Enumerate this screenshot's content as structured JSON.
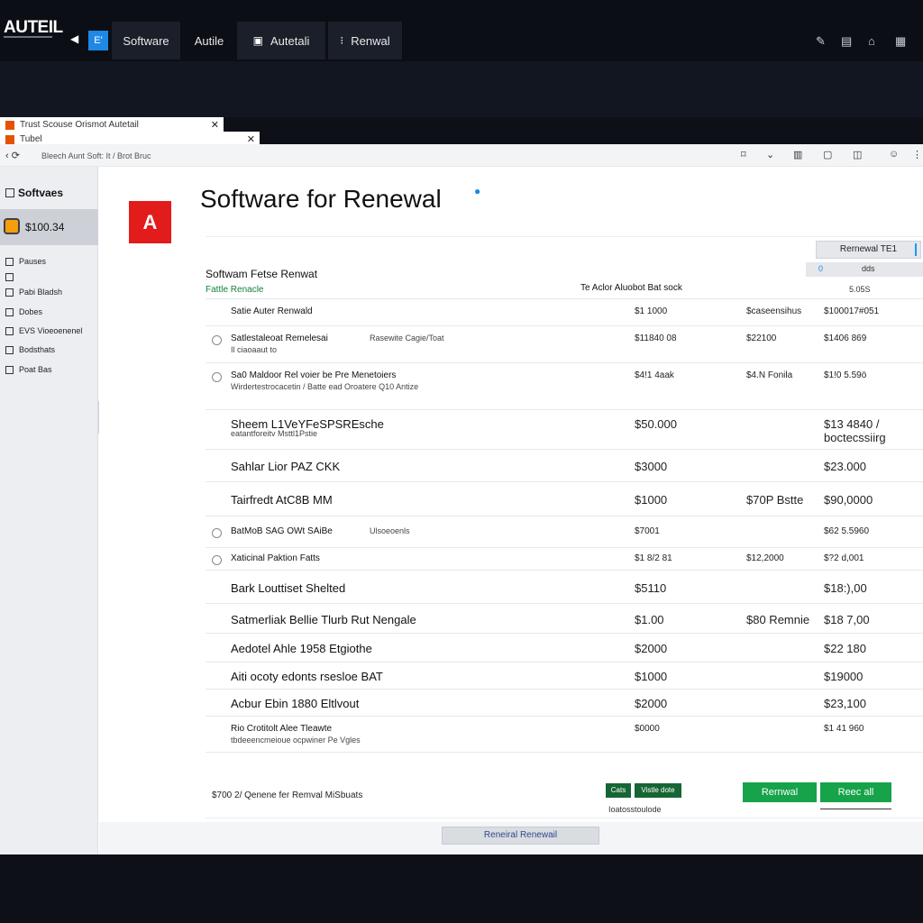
{
  "app": {
    "logo": "AUTEIL",
    "nav": [
      {
        "label": "Software",
        "icon": "square-icon"
      },
      {
        "label": "Autile"
      },
      {
        "label": "Autetali"
      },
      {
        "label": "Renwal"
      }
    ],
    "nav_square_text": "E'"
  },
  "browser": {
    "tabs": [
      {
        "label": "Trust Scouse Orismot Autetail"
      },
      {
        "label": "Tubel"
      }
    ],
    "url": "Bleech Aunt Soft: It / Brot Bruc"
  },
  "sidebar": {
    "title": "Softvaes",
    "active_item": "$100.34",
    "items": [
      {
        "label": "Pauses"
      },
      {
        "label": "Pabi Bladsh"
      },
      {
        "label": "Dobes"
      },
      {
        "label": "EVS Vioeoenenel"
      },
      {
        "label": "Bodsthats"
      },
      {
        "label": "Poat Bas"
      }
    ]
  },
  "main": {
    "brand_letter": "A",
    "title": "Software for Renewal",
    "top_button": "Rernewal TE1",
    "filter": {
      "a": "0",
      "b": "dds"
    },
    "section_title": "Softwam Fetse Renwat",
    "section_subtitle": "Fattle Renacle",
    "column_header": "Te Aclor Aluobot Bat sock",
    "column_header2": "5.05S"
  },
  "table": {
    "rows": [
      {
        "name": "Satie Auter Renwald",
        "name2": "",
        "desc": "",
        "p1": "$1 1000",
        "p2": "$caseensihus",
        "p3": "$100017#051",
        "checkbox": false,
        "big": false
      },
      {
        "name": "Satlestaleoat Remelesai",
        "name2": "Il ciaoaaut to",
        "desc": "Rasewite Cagie/Toat",
        "p1": "$11840 08",
        "p2": "$22100",
        "p3": "$1406 869",
        "checkbox": true,
        "big": false
      },
      {
        "name": "Sa0 Maldoor Rel voier be Pre Menetoiers",
        "name2": "Wirdertestrocacetin / Batte ead Oroatere Q10 Antize",
        "desc": "",
        "p1": "$4!1 4aak",
        "p2": "$4.N Fonila",
        "p3": "$1!0 5.59ö",
        "checkbox": true,
        "big": false
      },
      {
        "name": "Sheem L1VeYFeSPSREsche",
        "name2": "eatantforeitv Msttl1Pstie",
        "desc": "",
        "p1": "$50.000",
        "p2": "",
        "p3": "$13 4840 / boctecssiirg",
        "checkbox": false,
        "big": true
      },
      {
        "name": "Sahlar Lior PAZ CKK",
        "name2": "",
        "desc": "",
        "p1": "$3000",
        "p2": "",
        "p3": "$23.000",
        "checkbox": false,
        "big": true
      },
      {
        "name": "Tairfredt AtC8B MM",
        "name2": "",
        "desc": "",
        "p1": "$1000",
        "p2": "$70P Bstte",
        "p3": "$90,0000",
        "checkbox": false,
        "big": true
      },
      {
        "name": "BatMoB SAG OWt SAiBe",
        "name2": "",
        "desc": "Ulsoeoenls",
        "p1": "$7001",
        "p2": "",
        "p3": "$62 5.5960",
        "checkbox": true,
        "big": false
      },
      {
        "name": "Xaticinal Paktion Fatts",
        "name2": "",
        "desc": "",
        "p1": "$1 8/2 81",
        "p2": "$12,2000",
        "p3": "$?2 d,001",
        "checkbox": true,
        "big": false
      },
      {
        "name": "Bark Louttiset Shelted",
        "name2": "",
        "desc": "",
        "p1": "$5110",
        "p2": "",
        "p3": "$18:),00",
        "checkbox": false,
        "big": true
      },
      {
        "name": "Satmerliak Bellie Tlurb Rut Nengale",
        "name2": "",
        "desc": "",
        "p1": "$1.00",
        "p2": "$80 Remnie",
        "p3": "$18 7,00",
        "checkbox": false,
        "big": true
      },
      {
        "name": "Aedotel Ahle 1958 Etgiothe",
        "name2": "",
        "desc": "",
        "p1": "$2000",
        "p2": "",
        "p3": "$22 180",
        "checkbox": false,
        "big": true
      },
      {
        "name": "Aiti ocoty edonts rsesloe BAT",
        "name2": "",
        "desc": "",
        "p1": "$1000",
        "p2": "",
        "p3": "$19000",
        "checkbox": false,
        "big": true
      },
      {
        "name": "Acbur Ebin 1880 Eltlvout",
        "name2": "",
        "desc": "",
        "p1": "$2000",
        "p2": "",
        "p3": "$23,100",
        "checkbox": false,
        "big": true
      },
      {
        "name": "Rio Crotitolt Alee Tleawte",
        "name2": "tbdeeencmeioue ocpwiner Pe Vgles",
        "desc": "",
        "p1": "$0000",
        "p2": "",
        "p3": "$1 41 960",
        "checkbox": false,
        "big": false
      }
    ]
  },
  "footer": {
    "summary": "$700 2/ Qenene fer Remval MiSbuats",
    "mini_btn1": "Cats",
    "mini_btn2": "Vistle dote",
    "mini_caption": "Ioatosstoulode",
    "renewal_btn": "Rernwal",
    "recall_btn": "Reec all",
    "bottom_btn": "Reneiral Renewail"
  }
}
